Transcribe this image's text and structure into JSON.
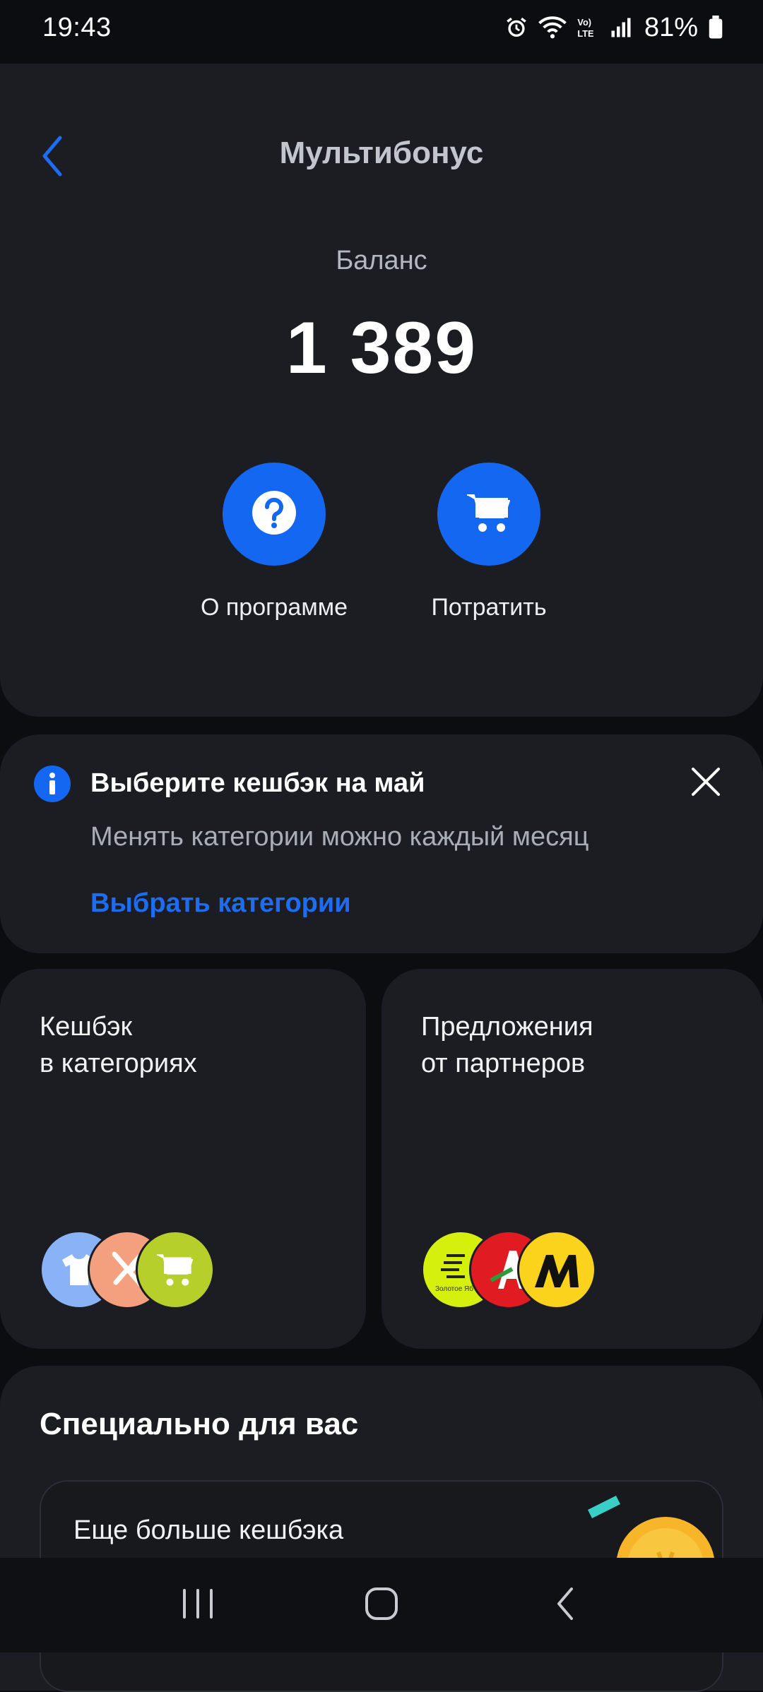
{
  "status_bar": {
    "time": "19:43",
    "battery": "81%",
    "icons": [
      "alarm-icon",
      "wifi-icon",
      "volte-icon",
      "signal-icon",
      "battery-icon"
    ]
  },
  "header": {
    "title": "Мультибонус",
    "back_icon": "chevron-left-icon"
  },
  "balance": {
    "label": "Баланс",
    "value": "1 389"
  },
  "actions": [
    {
      "label": "О программе",
      "icon": "question-icon"
    },
    {
      "label": "Потратить",
      "icon": "cart-icon"
    }
  ],
  "cashback_banner": {
    "title": "Выберите кешбэк на май",
    "subtitle": "Менять категории можно каждый месяц",
    "link": "Выбрать категории",
    "icon": "info-icon",
    "close_icon": "close-icon"
  },
  "tiles": [
    {
      "title_line1": "Кешбэк",
      "title_line2": "в категориях",
      "icons": [
        "clothes-icon",
        "restaurant-icon",
        "grocery-cart-icon"
      ]
    },
    {
      "title_line1": "Предложения",
      "title_line2": "от партнеров",
      "icons": [
        "zolotoe-yabloko-logo",
        "auchan-logo",
        "yandex-market-logo"
      ],
      "logo_caption": "Золотое Яб"
    }
  ],
  "special": {
    "title": "Специально для вас",
    "promo_title": "Еще больше кешбэка"
  },
  "nav_bar": {
    "icons": [
      "recent-apps-icon",
      "home-icon",
      "back-icon"
    ]
  },
  "colors": {
    "accent": "#1467f0",
    "link": "#1d6cf2",
    "card": "#1b1d22",
    "background": "#0c0d10"
  }
}
